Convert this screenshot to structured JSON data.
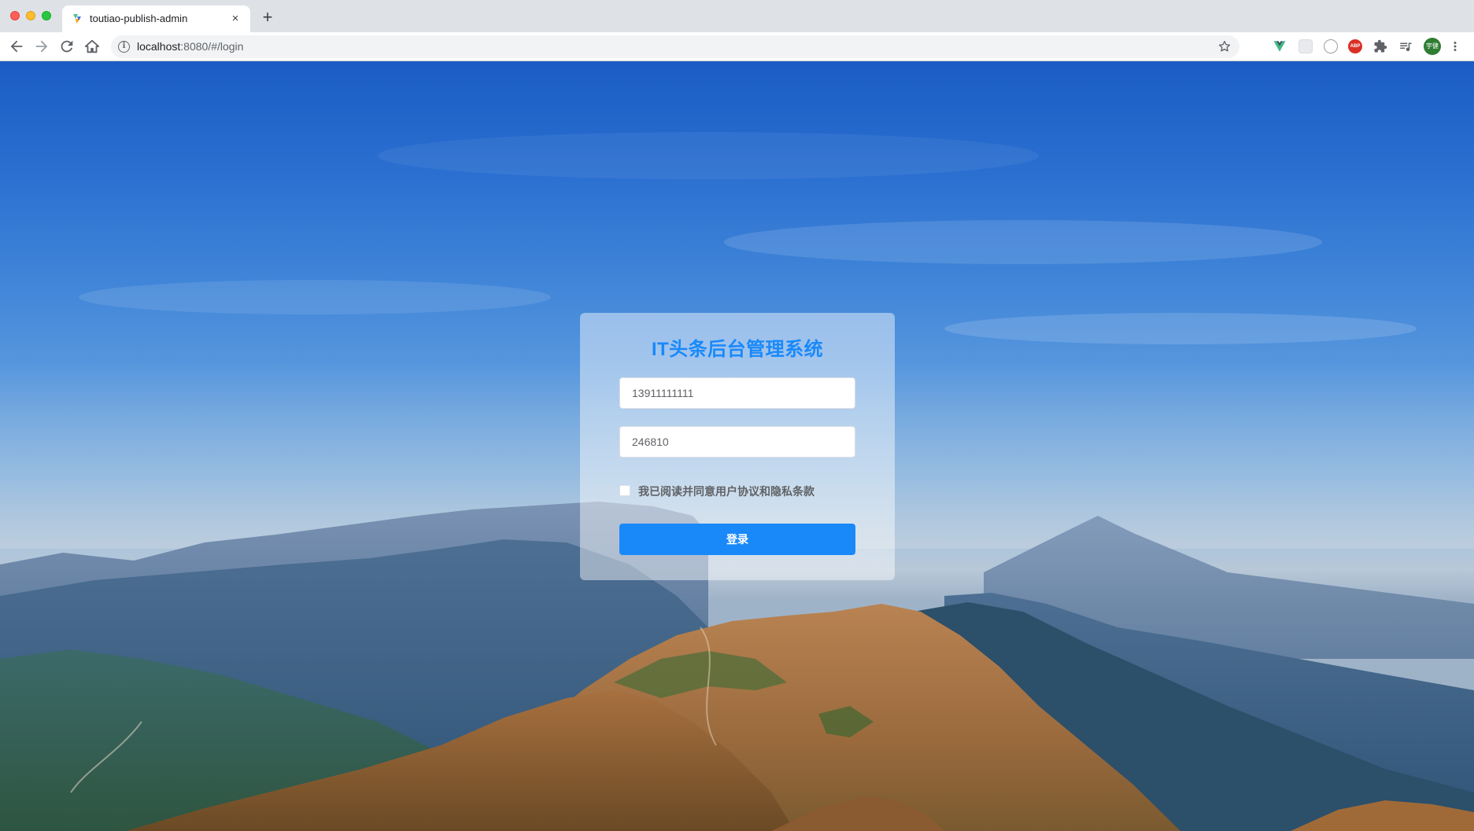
{
  "browser": {
    "tab": {
      "title": "toutiao-publish-admin",
      "close_glyph": "×",
      "favicon_icon": "vue-style-favicon-icon"
    },
    "new_tab_glyph": "+",
    "omnibox": {
      "host": "localhost",
      "path": ":8080/#/login",
      "info_glyph": "i"
    },
    "extensions": {
      "abp_label": "ABP",
      "avatar_label": "宇健"
    },
    "icons": {
      "back": "arrow-left-icon",
      "forward": "arrow-right-icon",
      "reload": "reload-icon",
      "home": "home-icon",
      "bookmark": "star-icon",
      "vue_devtools": "vue-devtools-icon",
      "extension_grid": "grid-extension-icon",
      "extension_clock": "clock-extension-icon",
      "extensions_menu": "puzzle-icon",
      "media_controls": "media-queue-icon",
      "menu": "kebab-menu-icon"
    }
  },
  "login": {
    "title": "IT头条后台管理系统",
    "mobile_value": "13911111111",
    "code_value": "246810",
    "agree_label": "我已阅读并同意用户协议和隐私条款",
    "agree_checked": false,
    "submit_label": "登录"
  },
  "colors": {
    "accent": "#1989fa",
    "chrome_bg": "#dee1e6",
    "sky_top": "#1a5cc4"
  }
}
